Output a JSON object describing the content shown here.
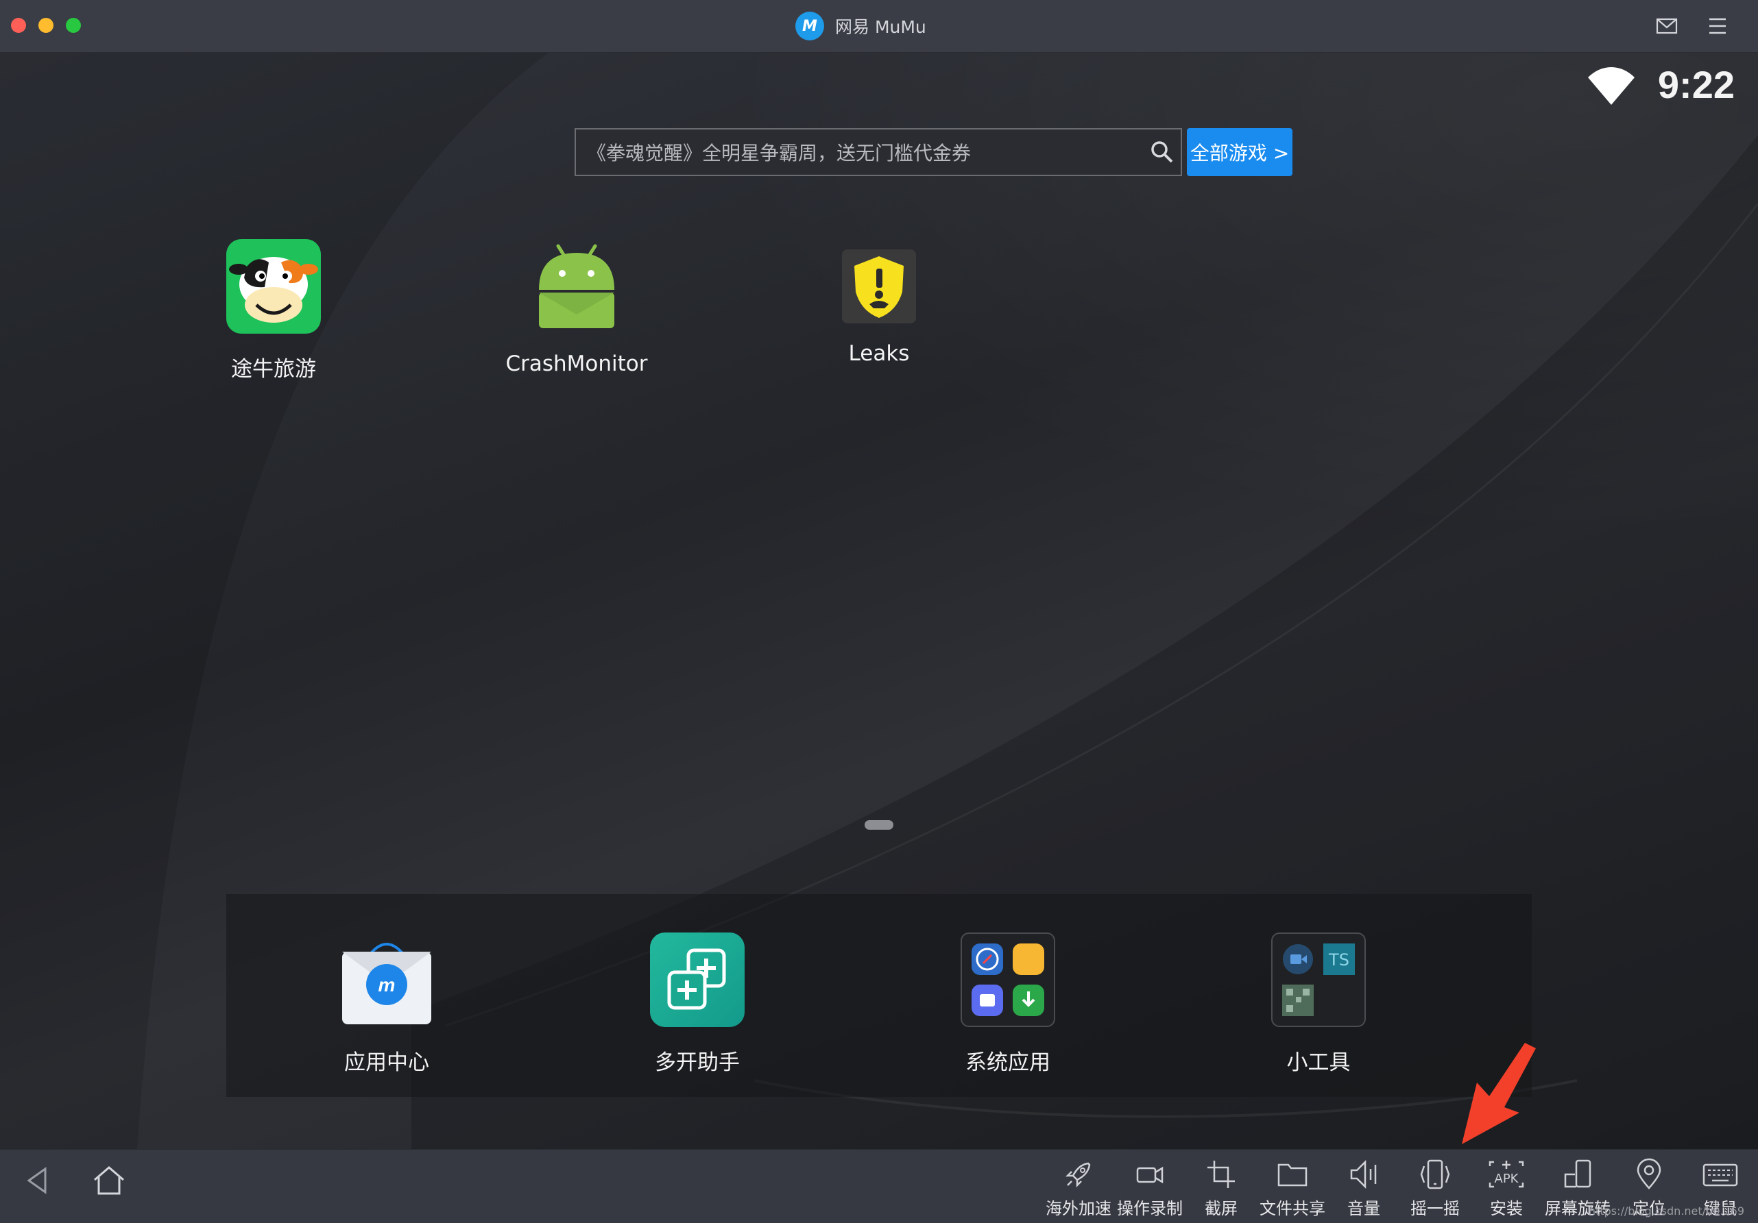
{
  "window": {
    "title": "网易 MuMu",
    "logo_text": "M"
  },
  "status_bar": {
    "time": "9:22"
  },
  "search": {
    "placeholder": "《拳魂觉醒》全明星争霸周，送无门槛代金券",
    "all_games_label": "全部游戏 >"
  },
  "home_apps": [
    {
      "label": "途牛旅游",
      "icon": "tuniu-cow-icon"
    },
    {
      "label": "CrashMonitor",
      "icon": "android-icon"
    },
    {
      "label": "Leaks",
      "icon": "leaks-shield-icon"
    }
  ],
  "dock_apps": [
    {
      "label": "应用中心",
      "icon": "app-center-bag-icon"
    },
    {
      "label": "多开助手",
      "icon": "multi-open-icon"
    },
    {
      "label": "系统应用",
      "icon": "system-apps-folder-icon"
    },
    {
      "label": "小工具",
      "icon": "tools-folder-icon"
    }
  ],
  "toolbar": {
    "tools": [
      {
        "label": "海外加速",
        "icon": "rocket-icon"
      },
      {
        "label": "操作录制",
        "icon": "video-camera-icon"
      },
      {
        "label": "截屏",
        "icon": "crop-icon"
      },
      {
        "label": "文件共享",
        "icon": "folder-icon"
      },
      {
        "label": "音量",
        "icon": "volume-icon"
      },
      {
        "label": "摇一摇",
        "icon": "shake-phone-icon"
      },
      {
        "label": "安装",
        "icon": "apk-install-icon"
      },
      {
        "label": "屏幕旋转",
        "icon": "rotate-screen-icon"
      },
      {
        "label": "定位",
        "icon": "location-pin-icon"
      },
      {
        "label": "键鼠",
        "icon": "keyboard-icon"
      }
    ]
  },
  "watermark": "https://blog.csdn.net/u0...69",
  "colors": {
    "accent": "#1a8cf0",
    "annotation_arrow": "#f2402a"
  }
}
